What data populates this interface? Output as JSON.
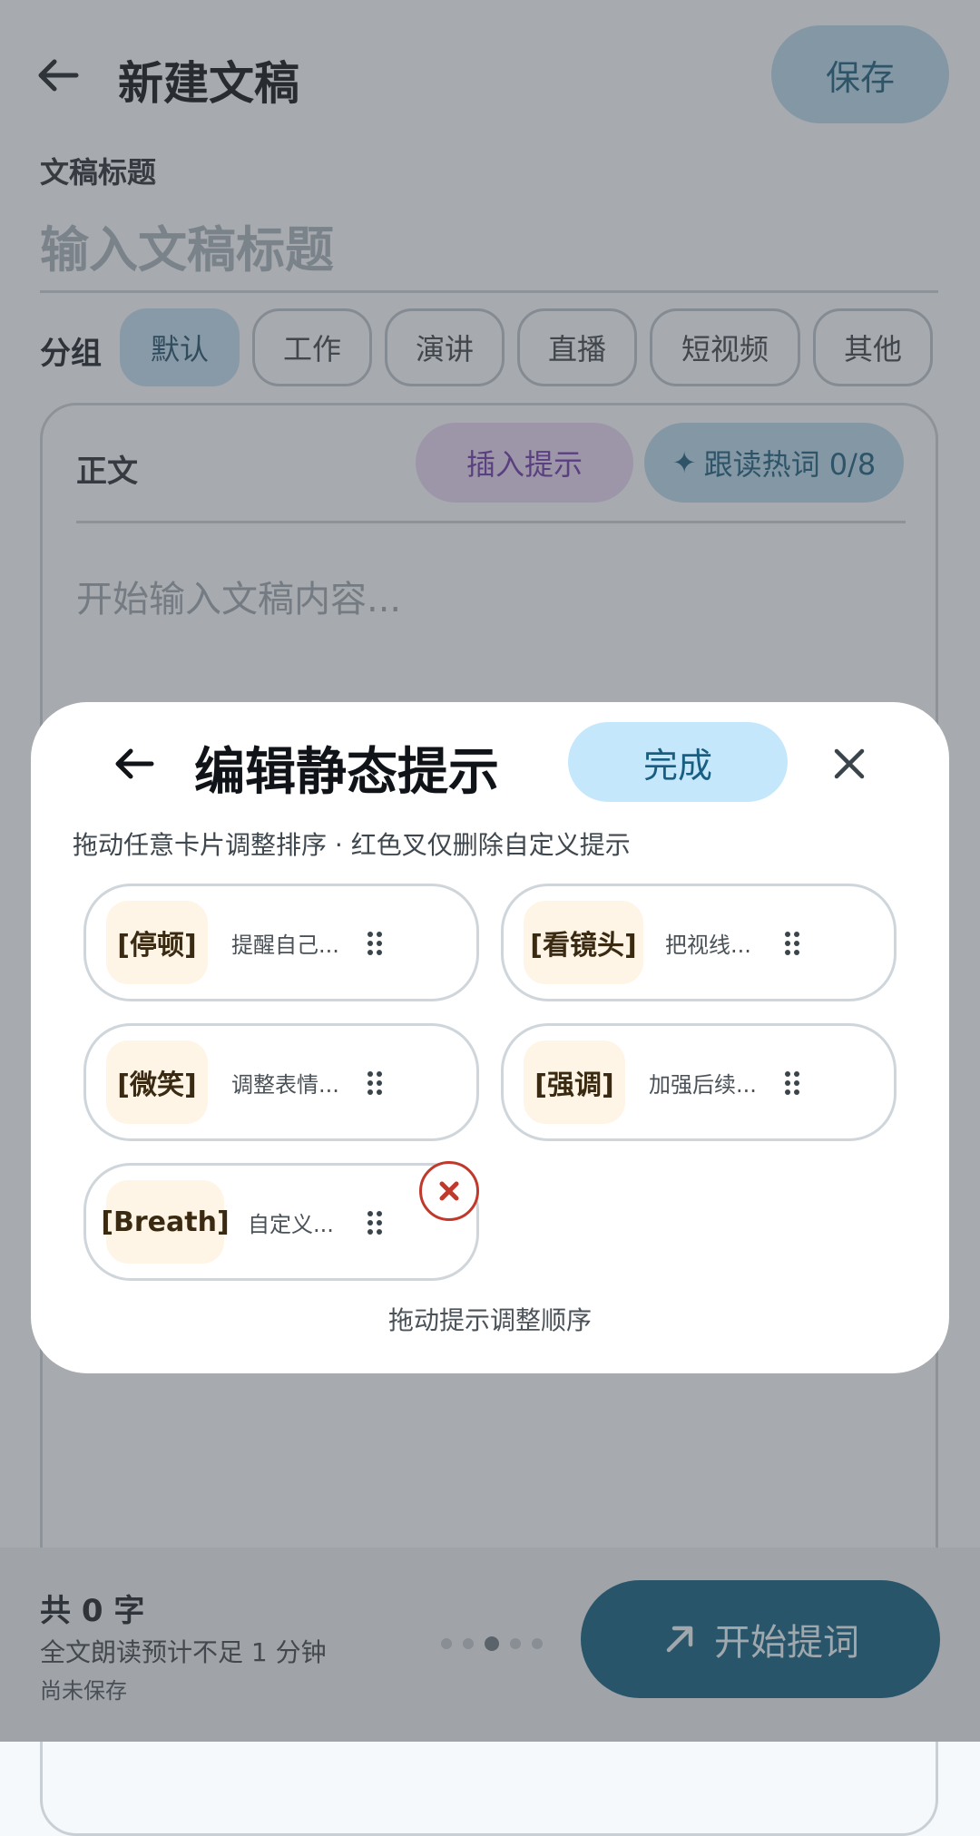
{
  "header": {
    "title": "新建文稿",
    "save_label": "保存"
  },
  "form": {
    "title_label": "文稿标题",
    "title_placeholder": "输入文稿标题",
    "group_label": "分组",
    "groups": [
      "默认",
      "工作",
      "演讲",
      "直播",
      "短视频",
      "其他"
    ],
    "selected_group": "默认",
    "body_label": "正文",
    "insert_label": "插入提示",
    "hotword_label": "跟读热词 0/8",
    "content_placeholder": "开始输入文稿内容..."
  },
  "footer": {
    "count_label": "共 0 字",
    "read_estimate": "全文朗读预计不足 1 分钟",
    "save_status": "尚未保存",
    "page_dots": 5,
    "active_dot": 2,
    "start_label": "开始提词"
  },
  "modal": {
    "title": "编辑静态提示",
    "done_label": "完成",
    "subtitle": "拖动任意卡片调整排序 · 红色叉仅删除自定义提示",
    "cards": [
      {
        "tag": "[停顿]",
        "desc": "提醒自己..."
      },
      {
        "tag": "[看镜头]",
        "desc": "把视线..."
      },
      {
        "tag": "[微笑]",
        "desc": "调整表情..."
      },
      {
        "tag": "[强调]",
        "desc": "加强后续..."
      },
      {
        "tag": "[Breath]",
        "desc": "自定义..."
      }
    ],
    "hint": "拖动提示调整顺序"
  },
  "colors": {
    "accent": "#0f5f7f",
    "delete": "#c0392b",
    "tag_bg": "#fff5e6",
    "done_bg": "#c5e7fb"
  },
  "icons": [
    "back-arrow-icon",
    "sparkle-icon",
    "close-icon",
    "drag-grip-icon",
    "delete-x-icon",
    "arrow-up-right-icon"
  ]
}
